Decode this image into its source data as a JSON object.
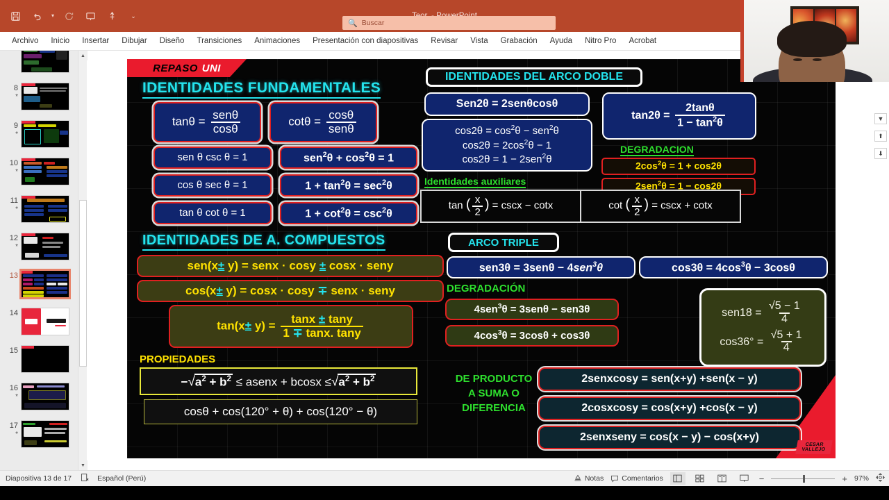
{
  "window": {
    "title": "Teor.  -  PowerPoint",
    "quick_access": [
      "save-icon",
      "undo-icon",
      "redo-icon",
      "present-icon",
      "pen-icon",
      "customize-icon"
    ]
  },
  "search": {
    "placeholder": "Buscar",
    "icon": "search-icon"
  },
  "ribbon": {
    "tabs": [
      "Archivo",
      "Inicio",
      "Insertar",
      "Dibujar",
      "Diseño",
      "Transiciones",
      "Animaciones",
      "Presentación con diapositivas",
      "Revisar",
      "Vista",
      "Grabación",
      "Ayuda",
      "Nitro Pro",
      "Acrobat"
    ]
  },
  "slide_panel": {
    "thumbnails": [
      {
        "number": "",
        "star": "*",
        "selected": false
      },
      {
        "number": "8",
        "star": "*",
        "selected": false
      },
      {
        "number": "9",
        "star": "*",
        "selected": false
      },
      {
        "number": "10",
        "star": "*",
        "selected": false
      },
      {
        "number": "11",
        "star": "*",
        "selected": false
      },
      {
        "number": "12",
        "star": "*",
        "selected": false
      },
      {
        "number": "13",
        "star": "",
        "selected": true
      },
      {
        "number": "14",
        "star": "",
        "selected": false
      },
      {
        "number": "15",
        "star": "",
        "selected": false
      },
      {
        "number": "16",
        "star": "*",
        "selected": false
      },
      {
        "number": "17",
        "star": "*",
        "selected": false
      }
    ]
  },
  "slide": {
    "badge": {
      "part1": "REPASO",
      "part2": "UNI"
    },
    "headings": {
      "fundamentales": "IDENTIDADES  FUNDAMENTALES",
      "compuestos": "IDENTIDADES  DE A. COMPUESTOS",
      "arco_doble": "IDENTIDADES DEL ARCO DOBLE",
      "arco_triple": "ARCO TRIPLE",
      "aux": "Identidades auxiliares",
      "degradacion_doble": "DEGRADACION",
      "degradacion_triple": "DEGRADACIÓN",
      "propiedades": "PROPIEDADES",
      "producto_l1": "DE PRODUCTO",
      "producto_l2": "A SUMA O",
      "producto_l3": "DIFERENCIA"
    },
    "fundamentales": {
      "tan_lhs": "tanθ =",
      "tan_num": "senθ",
      "tan_den": "cosθ",
      "cot_lhs": "cotθ =",
      "cot_num": "cosθ",
      "cot_den": "senθ",
      "r1c1": "sen θ csc θ = 1",
      "r2c1": "cos θ sec θ = 1",
      "r3c1": "tan θ cot θ = 1",
      "r1c2_a": "sen",
      "r1c2_b": "2",
      "r1c2_c": "θ + cos",
      "r1c2_d": "2",
      "r1c2_e": "θ = 1",
      "r2c2_a": "1 + tan",
      "r2c2_b": "2",
      "r2c2_c": "θ = sec",
      "r2c2_d": "2",
      "r2c2_e": "θ",
      "r3c2_a": "1 + cot",
      "r3c2_b": "2",
      "r3c2_c": "θ = csc",
      "r3c2_d": "2",
      "r3c2_e": "θ"
    },
    "arco_doble": {
      "sen2": "Sen2θ = 2senθcosθ",
      "cos2_l1_a": "cos2θ = cos",
      "cos2_l1_b": "2",
      "cos2_l1_c": "θ − sen",
      "cos2_l1_d": "2",
      "cos2_l1_e": "θ",
      "cos2_l2_a": "cos2θ = 2cos",
      "cos2_l2_b": "2",
      "cos2_l2_c": "θ − 1",
      "cos2_l3_a": "cos2θ = 1 − 2sen",
      "cos2_l3_b": "2",
      "cos2_l3_c": "θ",
      "tan2_lhs": "tan2θ =",
      "tan2_num": "2tanθ",
      "tan2_den_a": "1 − tan",
      "tan2_den_b": "2",
      "tan2_den_c": "θ",
      "deg1_a": "2cos",
      "deg1_b": "2",
      "deg1_c": "θ = 1 + cos2θ",
      "deg2_a": "2sen",
      "deg2_b": "2",
      "deg2_c": "θ = 1 − cos2θ"
    },
    "auxiliares": {
      "left_lhs": "tan",
      "left_num": "x",
      "left_den": "2",
      "left_rhs": "= cscx − cotx",
      "right_lhs": "cot",
      "right_num": "x",
      "right_den": "2",
      "right_rhs": "= cscx + cotx"
    },
    "compuestos": {
      "sen_a": "sen(x",
      "sen_pm": "±",
      "sen_b": " y) = senx · cosy ",
      "sen_pm2": "±",
      "sen_c": " cosx · seny",
      "cos_a": "cos(x",
      "cos_pm": "±",
      "cos_b": " y) = cosx · cosy ",
      "cos_mp": "∓",
      "cos_c": " senx · seny",
      "tan_lhs_a": "tan(x",
      "tan_pm": "±",
      "tan_lhs_b": " y) =",
      "tan_num_a": "tanx ",
      "tan_num_pm": "±",
      "tan_num_b": " tany",
      "tan_den_a": "1 ",
      "tan_den_mp": "∓",
      "tan_den_b": " tanx. tany"
    },
    "arco_triple": {
      "sen3_a": "sen3θ = 3senθ − 4",
      "sen3_b": "sen",
      "sen3_c": "3",
      "sen3_d": "θ",
      "cos3_a": "cos3θ = 4cos",
      "cos3_b": "3",
      "cos3_c": "θ − 3cosθ",
      "deg1_a": "4sen",
      "deg1_b": "3",
      "deg1_c": "θ = 3senθ − sen3θ",
      "deg2_a": "4cos",
      "deg2_b": "3",
      "deg2_c": "θ = 3cosθ + cos3θ"
    },
    "special_values": {
      "sen18_lhs": "sen18 =",
      "sen18_num": "√5 − 1",
      "sen18_den": "4",
      "cos36_lhs": "cos36° =",
      "cos36_num": "√5 + 1",
      "cos36_den": "4"
    },
    "propiedades": {
      "p1_a": "−",
      "p1_rad1": "a",
      "p1_sup1": "2",
      "p1_plus": " + b",
      "p1_sup2": "2",
      "p1_mid": " ≤ asenx + bcosx ≤",
      "p1_rad2": "a",
      "p1_sup3": "2",
      "p1_plus2": " + b",
      "p1_sup4": "2",
      "p2": "cosθ + cos(120° + θ) + cos(120° − θ)"
    },
    "producto_suma": {
      "f1": "2senxcosy = sen(x+y) +sen(x − y)",
      "f2": "2cosxcosy =  cos(x+y) +cos(x − y)",
      "f3": "2senxseny = cos(x − y) − cos(x+y)"
    },
    "logo": {
      "line1": "CESAR",
      "line2": "VALLEJO"
    }
  },
  "statusbar": {
    "slide_indicator": "Diapositiva 13 de 17",
    "accessibility_icon": "accessibility-icon",
    "language": "Español (Perú)",
    "notes": "Notas",
    "comments": "Comentarios",
    "views": [
      "normal-view-icon",
      "slide-sorter-icon",
      "reading-view-icon",
      "slideshow-icon"
    ],
    "zoom_out": "−",
    "zoom_in": "+",
    "zoom_level": "97%",
    "fit_icon": "fit-to-window-icon"
  }
}
